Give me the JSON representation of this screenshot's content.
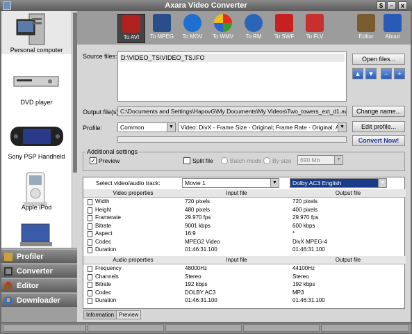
{
  "window": {
    "title": "Axara Video Converter",
    "help": "$",
    "minimize": "–",
    "close": "x"
  },
  "devices": [
    {
      "label": "Personal computer",
      "icon": "personal-computer-icon"
    },
    {
      "label": "DVD player",
      "icon": "dvd-player-icon"
    },
    {
      "label": "Sony PSP Handheld",
      "icon": "psp-icon"
    },
    {
      "label": "Apple iPod",
      "icon": "ipod-icon"
    }
  ],
  "nav": {
    "profiler": "Profiler",
    "converter": "Converter",
    "editor": "Editor",
    "downloader": "Downloader"
  },
  "formats": [
    {
      "label": "To AVI",
      "color": "#b02020"
    },
    {
      "label": "To MPEG",
      "color": "#2a4e8a"
    },
    {
      "label": "To MOV",
      "color": "#1f6fd0"
    },
    {
      "label": "To WMV",
      "color": "#3a9a2a"
    },
    {
      "label": "To RM",
      "color": "#2a66b8"
    },
    {
      "label": "To SWF",
      "color": "#c82020"
    },
    {
      "label": "To FLV",
      "color": "#c83030"
    }
  ],
  "tools": {
    "editor": "Editor",
    "about": "About"
  },
  "source": {
    "label": "Source files:",
    "files": "D:\\VIDEO_TS\\VIDEO_TS.IFO",
    "open": "Open files..."
  },
  "output": {
    "label": "Output file(s):",
    "path": "C:\\Documents and Settings\\HapovG\\My Documents\\My Videos\\Two_towers_ext_d1.avi",
    "change": "Change name..."
  },
  "profile": {
    "label": "Profile:",
    "value": "Common",
    "details": "Video: DivX - Frame Size - Original; Frame Rate - Original; Audio: M",
    "edit": "Edit profile...",
    "convert": "Convert Now!"
  },
  "additional": {
    "legend": "Additional settings",
    "preview": "Preview",
    "split": "Split file",
    "batch": "Batch mode",
    "bysize": "By size",
    "size": "690 Mb"
  },
  "tracks": {
    "label": "Select video/audio track:",
    "video": "Movie 1",
    "audio": "Dolby AC3 English"
  },
  "video_table": {
    "headers": [
      "Video properties",
      "Input file",
      "Output file"
    ],
    "rows": [
      [
        "Width",
        "720 pixels",
        "720 pixels"
      ],
      [
        "Height",
        "480 pixels",
        "400 pixels"
      ],
      [
        "Framerate",
        "29.970 fps",
        "29.970 fps"
      ],
      [
        "Bitrate",
        "9001 kbps",
        "600 kbps"
      ],
      [
        "Aspect",
        "16:9",
        "*"
      ],
      [
        "Codec",
        "MPEG2 Video",
        "DivX MPEG-4"
      ],
      [
        "Duration",
        "01:46:31.100",
        "01:46:31.100"
      ]
    ]
  },
  "audio_table": {
    "headers": [
      "Audio properties",
      "Input file",
      "Output file"
    ],
    "rows": [
      [
        "Frequency",
        "48000Hz",
        "44100Hz"
      ],
      [
        "Channels",
        "Stereo",
        "Stereo"
      ],
      [
        "Bitrate",
        "192 kbps",
        "192 kbps"
      ],
      [
        "Codec",
        "DOLBY AC3",
        "MP3"
      ],
      [
        "Duration",
        "01:46:31.100",
        "01:46:31.100"
      ]
    ]
  },
  "tabs": {
    "information": "Information",
    "preview": "Preview"
  }
}
